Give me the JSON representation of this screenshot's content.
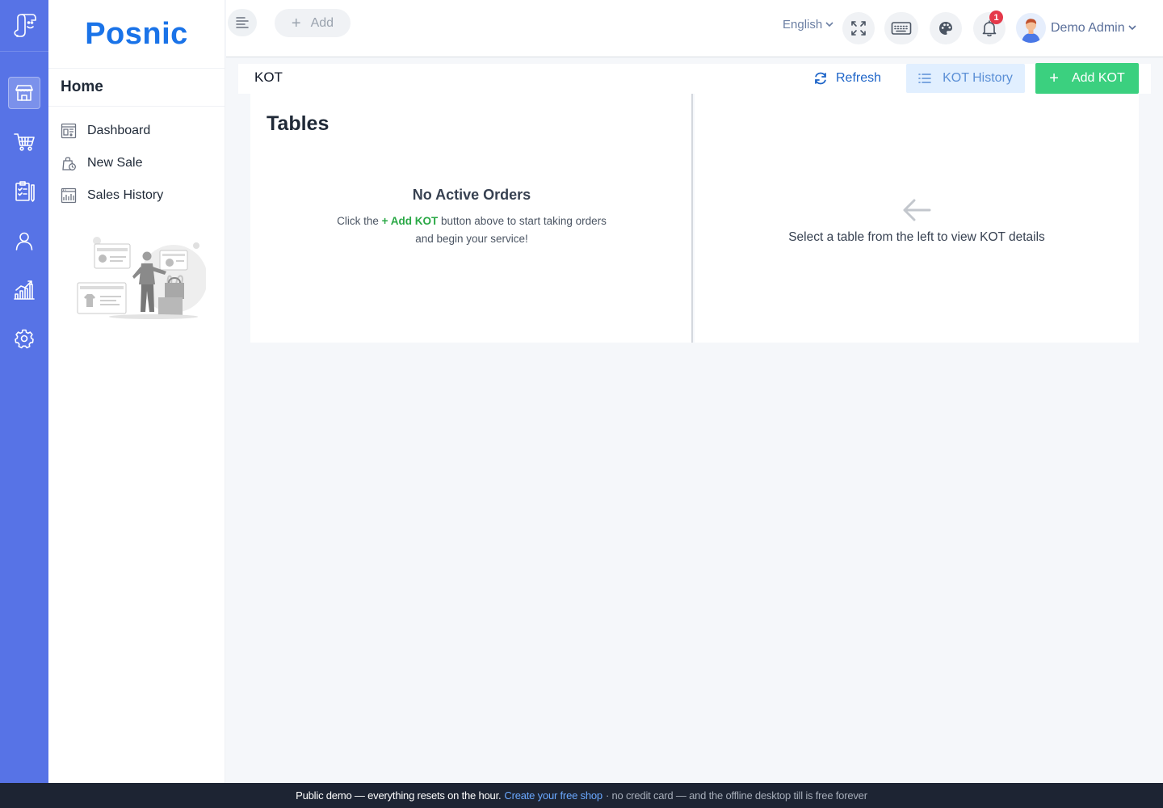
{
  "app": {
    "brand": "Posnic"
  },
  "header": {
    "add_label": "Add",
    "language": "English",
    "notification_count": "1",
    "user_name": "Demo Admin"
  },
  "sidebar": {
    "heading": "Home",
    "items": [
      {
        "label": "Dashboard",
        "icon": "dashboard-icon"
      },
      {
        "label": "New Sale",
        "icon": "new-sale-icon"
      },
      {
        "label": "Sales History",
        "icon": "sales-history-icon"
      }
    ]
  },
  "rail": {
    "icons": [
      "logo-icon",
      "store-icon",
      "cart-icon",
      "clipboard-icon",
      "user-icon",
      "chart-icon",
      "settings-icon"
    ]
  },
  "page": {
    "title": "KOT",
    "refresh_label": "Refresh",
    "history_label": "KOT History",
    "add_kot_label": "Add KOT"
  },
  "tables_panel": {
    "title": "Tables",
    "empty_title": "No Active Orders",
    "empty_prefix": "Click the ",
    "empty_accent": "+ Add KOT",
    "empty_suffix": " button above to start taking orders",
    "empty_line2": "and begin your service!"
  },
  "details_panel": {
    "message": "Select a table from the left to view KOT details"
  },
  "footer": {
    "part1": "Public demo — everything resets on the hour.",
    "link": "Create your free shop",
    "part2": "· no credit card — and the offline desktop till is free forever"
  },
  "colors": {
    "rail": "#5773e6",
    "brand": "#1a73e8",
    "add_kot": "#3bd07f",
    "accent_green": "#29a845",
    "footer_bg": "#1d2433",
    "footer_link": "#6aa8ff"
  }
}
